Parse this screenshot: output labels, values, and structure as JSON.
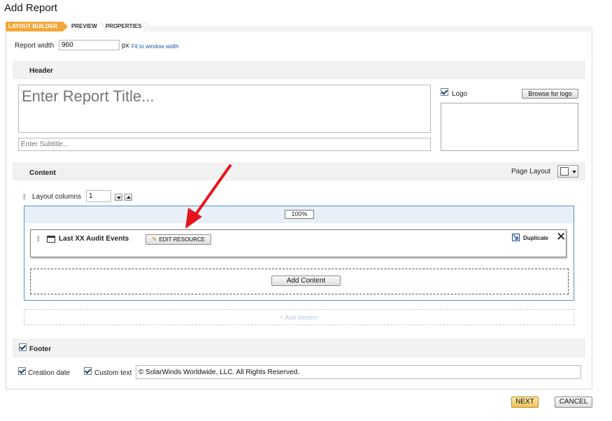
{
  "page": {
    "title": "Add Report"
  },
  "steps": [
    {
      "label": "LAYOUT BUILDER",
      "active": true
    },
    {
      "label": "PREVIEW",
      "active": false
    },
    {
      "label": "PROPERTIES",
      "active": false
    }
  ],
  "report_width": {
    "label": "Report width",
    "value": "960",
    "unit": "px",
    "fit_link": "Fit to window width"
  },
  "header": {
    "title": "Header",
    "report_title_placeholder": "Enter Report Title...",
    "subtitle_placeholder": "Enter Subtitle...",
    "logo_label": "Logo",
    "logo_checked": true,
    "browse_button": "Browse for logo"
  },
  "content": {
    "title": "Content",
    "page_layout_label": "Page Layout",
    "layout_columns_label": "Layout columns",
    "layout_columns_value": "1",
    "column_width": "100%",
    "resource": {
      "title": "Last XX Audit Events",
      "edit_button": "EDIT RESOURCE",
      "duplicate_label": "Duplicate"
    },
    "add_content_button": "Add Content",
    "add_section_label": "+ Add section"
  },
  "footer": {
    "title": "Footer",
    "footer_checked": true,
    "creation_date_label": "Creation date",
    "creation_date_checked": true,
    "custom_text_label": "Custom text",
    "custom_text_checked": true,
    "custom_text_value": "© SolarWinds Worldwide, LLC. All Rights Reserved."
  },
  "actions": {
    "next": "NEXT",
    "cancel": "CANCEL"
  },
  "colors": {
    "accent": "#f2a73a",
    "section_border": "#5a8fcb",
    "arrow": "#e8141b"
  },
  "icons": [
    "grip-icon",
    "resource-window-icon",
    "pencil-icon",
    "duplicate-icon",
    "close-icon",
    "page-layout-icon",
    "chevron-down-icon",
    "spin-down-icon",
    "spin-up-icon",
    "annotation-arrow-icon"
  ]
}
